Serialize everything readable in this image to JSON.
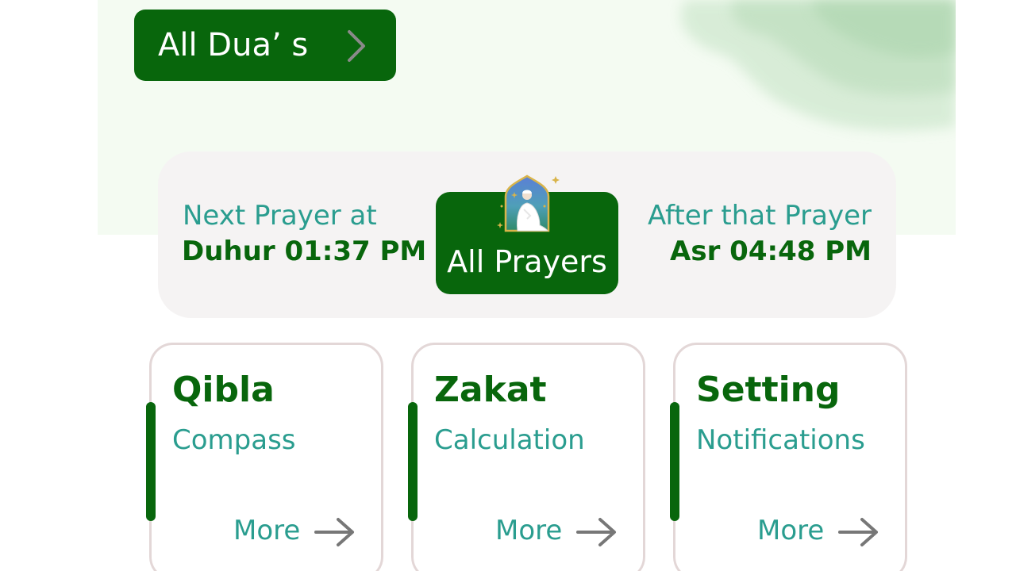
{
  "header": {
    "duas_button_label": "All Dua’ s",
    "chevron_icon": "chevron-right-icon"
  },
  "prayer_card": {
    "next_label": "Next Prayer at",
    "next_time": "Duhur 01:37 PM",
    "all_prayers_label": "All Prayers",
    "prayer_icon": "praying-person-icon",
    "after_label": "After that Prayer",
    "after_time": "Asr 04:48 PM"
  },
  "features": [
    {
      "title": "Qibla",
      "subtitle": "Compass",
      "more_label": "More",
      "icon": "arrow-right-icon"
    },
    {
      "title": "Zakat",
      "subtitle": "Calculation",
      "more_label": "More",
      "icon": "arrow-right-icon"
    },
    {
      "title": "Setting",
      "subtitle": "Notifications",
      "more_label": "More",
      "icon": "arrow-right-icon"
    }
  ],
  "colors": {
    "brand_green": "#08660c",
    "accent_teal": "#2a9d8f",
    "card_background": "#f5f3f3",
    "header_background": "#f4fbf2"
  }
}
